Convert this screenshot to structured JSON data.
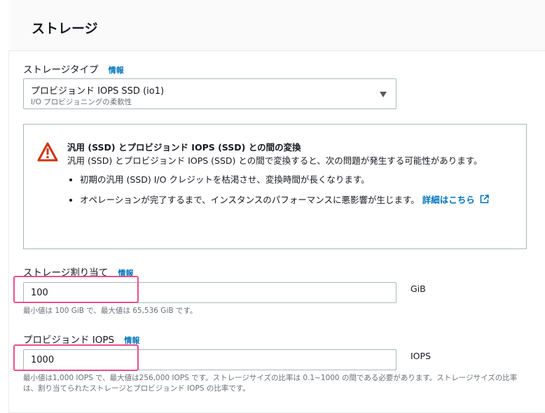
{
  "section": {
    "title": "ストレージ"
  },
  "storage_type": {
    "label": "ストレージタイプ",
    "info": "情報",
    "selected": "プロビジョンド IOPS SSD (io1)",
    "description": "I/O プロビジョニングの柔軟性"
  },
  "alert": {
    "title": "汎用 (SSD) とプロビジョンド IOPS (SSD) との間の変換",
    "body": "汎用 (SSD) とプロビジョンド IOPS (SSD) との間で変換すると、次の問題が発生する可能性があります。",
    "bullets": [
      "初期の汎用 (SSD) I/O クレジットを枯渇させ、変換時間が長くなります。",
      "オペレーションが完了するまで、インスタンスのパフォーマンスに悪影響が生じます。"
    ],
    "link": "詳細はこちら"
  },
  "allocation": {
    "label": "ストレージ割り当て",
    "info": "情報",
    "value": "100",
    "unit": "GiB",
    "hint": "最小値は 100 GiB で、最大値は 65,536 GiB です。"
  },
  "iops": {
    "label": "プロビジョンド IOPS",
    "info": "情報",
    "value": "1000",
    "unit": "IOPS",
    "hint": "最小値は1,000 IOPS で、最大値は256,000 IOPS です。ストレージサイズの比率は 0.1~1000 の間である必要があります。ストレージサイズの比率は、割り当てられたストレージとプロビジョンド IOPS の比率です。"
  },
  "colors": {
    "highlight": "#e8508a",
    "link": "#0073bb",
    "warning": "#d13212"
  }
}
